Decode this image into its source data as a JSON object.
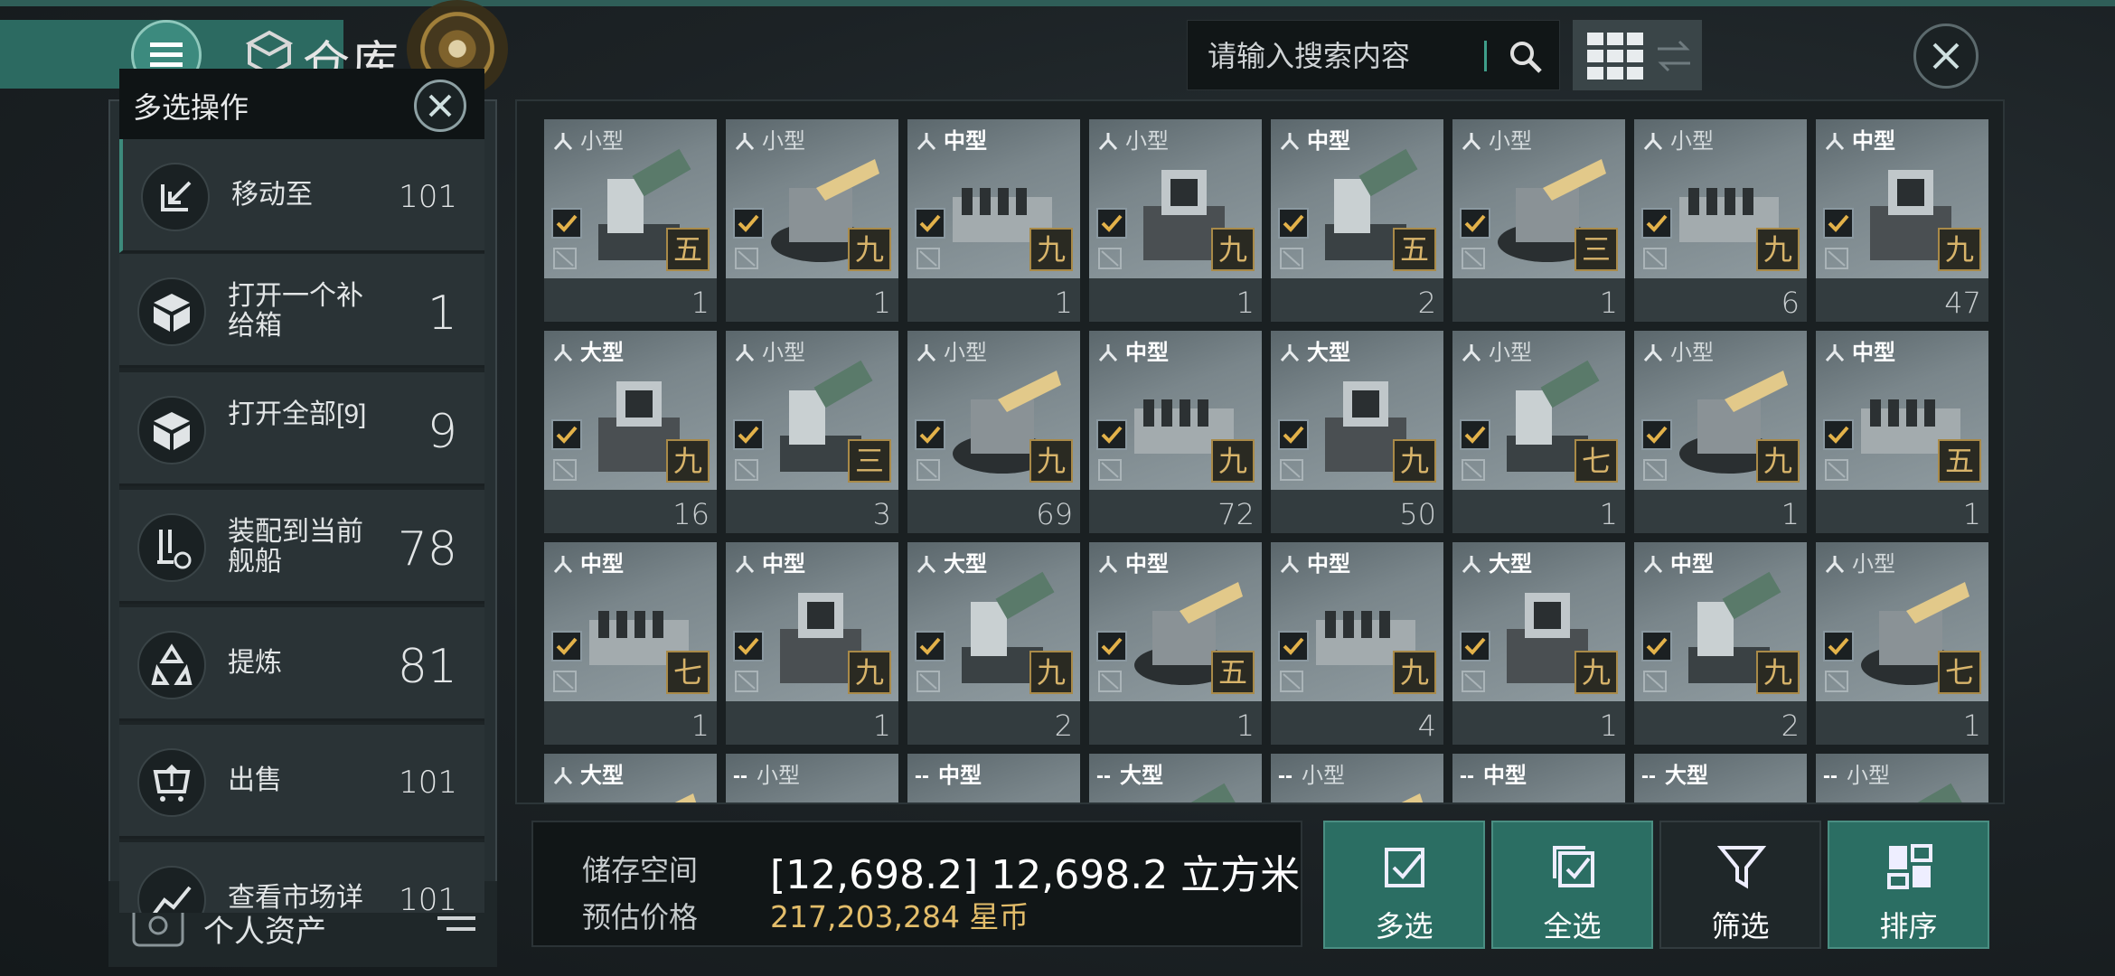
{
  "header": {
    "title": "仓库",
    "search_placeholder": "请输入搜索内容"
  },
  "multi_panel": {
    "title": "多选操作",
    "items": [
      {
        "label": "移动至",
        "count": "101",
        "icon": "move-icon"
      },
      {
        "label": "打开一个补给箱",
        "count": "1",
        "icon": "cube-icon"
      },
      {
        "label": "打开全部[9]",
        "count": "9",
        "icon": "cube-icon"
      },
      {
        "label": "装配到当前舰船",
        "count": "78",
        "icon": "equip-icon"
      },
      {
        "label": "提炼",
        "count": "81",
        "icon": "recycle-icon"
      },
      {
        "label": "出售",
        "count": "101",
        "icon": "sell-icon"
      },
      {
        "label": "查看市场详情",
        "count": "101",
        "icon": "market-icon"
      }
    ]
  },
  "left_panel": {
    "assets_label": "个人资产"
  },
  "grid": {
    "items": [
      {
        "size": "小型",
        "grade": "五",
        "count": "1",
        "checked": true
      },
      {
        "size": "小型",
        "grade": "九",
        "count": "1",
        "checked": true
      },
      {
        "size": "中型",
        "grade": "九",
        "count": "1",
        "checked": true
      },
      {
        "size": "小型",
        "grade": "九",
        "count": "1",
        "checked": true
      },
      {
        "size": "中型",
        "grade": "五",
        "count": "2",
        "checked": true
      },
      {
        "size": "小型",
        "grade": "三",
        "count": "1",
        "checked": true
      },
      {
        "size": "小型",
        "grade": "九",
        "count": "6",
        "checked": true
      },
      {
        "size": "中型",
        "grade": "九",
        "count": "47",
        "checked": true
      },
      {
        "size": "大型",
        "grade": "九",
        "count": "16",
        "checked": true
      },
      {
        "size": "小型",
        "grade": "三",
        "count": "3",
        "checked": true
      },
      {
        "size": "小型",
        "grade": "九",
        "count": "69",
        "checked": true
      },
      {
        "size": "中型",
        "grade": "九",
        "count": "72",
        "checked": true
      },
      {
        "size": "大型",
        "grade": "九",
        "count": "50",
        "checked": true
      },
      {
        "size": "小型",
        "grade": "七",
        "count": "1",
        "checked": true
      },
      {
        "size": "小型",
        "grade": "九",
        "count": "1",
        "checked": true
      },
      {
        "size": "中型",
        "grade": "五",
        "count": "1",
        "checked": true
      },
      {
        "size": "中型",
        "grade": "七",
        "count": "1",
        "checked": true
      },
      {
        "size": "中型",
        "grade": "九",
        "count": "1",
        "checked": true
      },
      {
        "size": "大型",
        "grade": "九",
        "count": "2",
        "checked": true
      },
      {
        "size": "中型",
        "grade": "五",
        "count": "1",
        "checked": true
      },
      {
        "size": "中型",
        "grade": "九",
        "count": "4",
        "checked": true
      },
      {
        "size": "大型",
        "grade": "九",
        "count": "1",
        "checked": true
      },
      {
        "size": "中型",
        "grade": "九",
        "count": "2",
        "checked": true
      },
      {
        "size": "小型",
        "grade": "七",
        "count": "1",
        "checked": true
      },
      {
        "size": "大型",
        "prefix": "",
        "partial": true
      },
      {
        "size": "小型",
        "prefix": "--",
        "partial": true
      },
      {
        "size": "中型",
        "prefix": "--",
        "partial": true
      },
      {
        "size": "大型",
        "prefix": "--",
        "partial": true
      },
      {
        "size": "小型",
        "prefix": "--",
        "partial": true
      },
      {
        "size": "中型",
        "prefix": "--",
        "partial": true
      },
      {
        "size": "大型",
        "prefix": "--",
        "partial": true
      },
      {
        "size": "小型",
        "prefix": "--",
        "partial": true
      }
    ]
  },
  "footer": {
    "storage_label": "储存空间",
    "storage_value": "[12,698.2] 12,698.2 立方米",
    "price_label": "预估价格",
    "price_value": "217,203,284 星币",
    "buttons": [
      {
        "label": "多选",
        "icon": "multi-check-icon",
        "active": true
      },
      {
        "label": "全选",
        "icon": "select-all-icon",
        "active": true
      },
      {
        "label": "筛选",
        "icon": "filter-icon",
        "active": false
      },
      {
        "label": "排序",
        "icon": "sort-icon",
        "active": true
      }
    ]
  }
}
